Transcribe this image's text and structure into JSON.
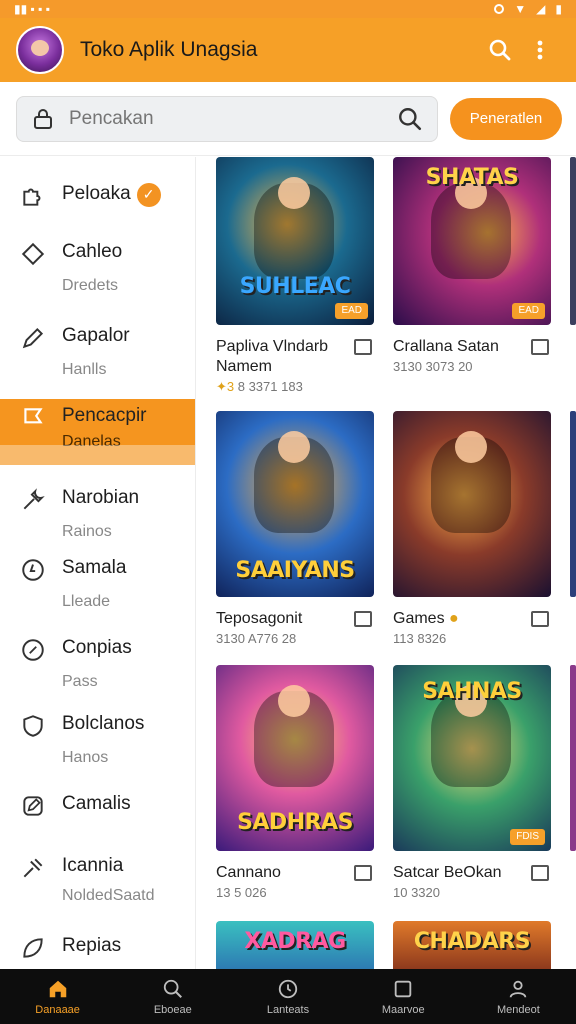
{
  "colors": {
    "accent": "#f6a027",
    "accent_dark": "#f5921e",
    "nav_bg": "#0d0d0d"
  },
  "app": {
    "title": "Toko Aplik Unagsia"
  },
  "search": {
    "placeholder": "Pencakan",
    "button_label": "Peneratlen"
  },
  "sidebar": {
    "items": [
      {
        "label": "Peloaka",
        "sub": "",
        "icon": "puzzle-icon",
        "verified": true
      },
      {
        "label": "Cahleo",
        "sub": "Dredets",
        "icon": "tag-icon"
      },
      {
        "label": "Gapalor",
        "sub": "Hanlls",
        "icon": "pen-icon"
      },
      {
        "label": "Pencacpir",
        "sub": "Danelas",
        "icon": "flag-icon",
        "active": true
      },
      {
        "label": "Narobian",
        "sub": "Rainos",
        "icon": "wrench-icon"
      },
      {
        "label": "Samala",
        "sub": "Lleade",
        "icon": "circle-icon"
      },
      {
        "label": "Conpias",
        "sub": "Pass",
        "icon": "compass-icon"
      },
      {
        "label": "Bolclanos",
        "sub": "Hanos",
        "icon": "shield-icon"
      },
      {
        "label": "Camalis",
        "sub": "",
        "icon": "edit-icon"
      },
      {
        "label": "Icannia",
        "sub": "NoldedSaatd",
        "icon": "tools-icon"
      },
      {
        "label": "Repias",
        "sub": "",
        "icon": "leaf-icon"
      }
    ]
  },
  "apps": [
    {
      "title": "Papliva Vlndarb Namem",
      "meta_accent": "✦3",
      "meta": " 8 3371 183",
      "logo": "SUHLEAC",
      "tag": "EAD"
    },
    {
      "title": "Crallana Satan",
      "meta": "3130 3073 20",
      "logo": "SHATAS",
      "tag": "EAD"
    },
    {
      "title": "Teposagonit",
      "meta": "3130 A776 28",
      "logo": "SAAIYANS"
    },
    {
      "title": "Games",
      "meta": "113 8326",
      "logo": "",
      "verified": true
    },
    {
      "title": "Cannano",
      "meta": "13 5 026",
      "logo": "SADHRAS"
    },
    {
      "title": "Satcar BeOkan",
      "meta": "10 3320",
      "logo": "SAHNAS",
      "tag": "FDIS"
    },
    {
      "title": "",
      "meta": "",
      "logo": "XADRAG"
    },
    {
      "title": "",
      "meta": "",
      "logo": "CHADARS"
    }
  ],
  "bottom_nav": [
    {
      "label": "Danaaae",
      "icon": "home-icon",
      "active": true
    },
    {
      "label": "Eboeae",
      "icon": "search-icon"
    },
    {
      "label": "Lanteats",
      "icon": "clock-icon"
    },
    {
      "label": "Maarvoe",
      "icon": "square-icon"
    },
    {
      "label": "Mendeot",
      "icon": "profile-icon"
    }
  ]
}
